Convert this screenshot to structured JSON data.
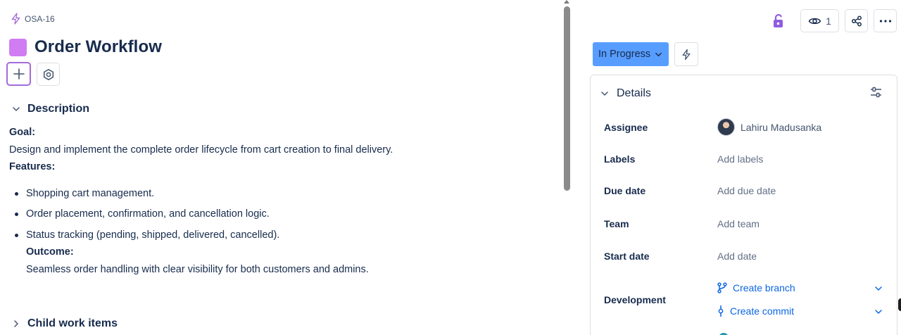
{
  "work_item": {
    "key": "OSA-16",
    "title": "Order Workflow",
    "type_color": "#d07cf2"
  },
  "description": {
    "section_label": "Description",
    "goal_label": "Goal:",
    "goal_text": "Design and implement the complete order lifecycle from cart creation to final delivery.",
    "features_label": "Features:",
    "features": [
      "Shopping cart management.",
      "Order placement, confirmation, and cancellation logic.",
      "Status tracking (pending, shipped, delivered, cancelled)."
    ],
    "outcome_label": "Outcome:",
    "outcome_text": "Seamless order handling with clear visibility for both customers and admins."
  },
  "child_items": {
    "section_label": "Child work items"
  },
  "toolbar": {
    "watch_count": "1",
    "icons": [
      "lock-open-icon",
      "eye-icon",
      "share-icon",
      "more-icon"
    ]
  },
  "status": {
    "label": "In Progress",
    "color": "#579dff"
  },
  "details": {
    "header": "Details",
    "fields": [
      {
        "label": "Assignee",
        "value": "Lahiru Madusanka"
      },
      {
        "label": "Labels",
        "value": "Add labels"
      },
      {
        "label": "Due date",
        "value": "Add due date"
      },
      {
        "label": "Team",
        "value": "Add team"
      },
      {
        "label": "Start date",
        "value": "Add date"
      },
      {
        "label": "Development",
        "value": ""
      }
    ],
    "development": {
      "create_branch": "Create branch",
      "create_commit": "Create commit"
    }
  }
}
